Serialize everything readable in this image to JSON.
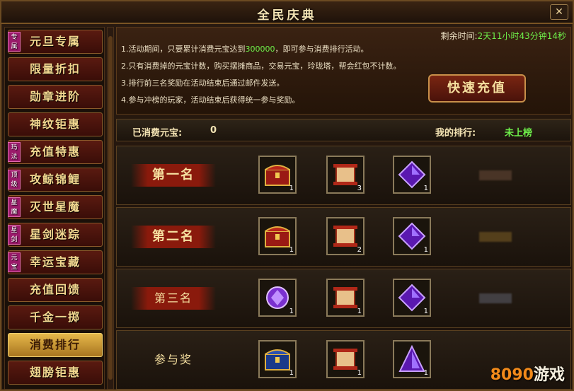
{
  "window": {
    "title": "全民庆典",
    "close_label": "✕"
  },
  "sidebar": {
    "items": [
      {
        "label": "元旦专属",
        "tag": "专属"
      },
      {
        "label": "限量折扣",
        "tag": ""
      },
      {
        "label": "勋章进阶",
        "tag": ""
      },
      {
        "label": "神纹钜惠",
        "tag": ""
      },
      {
        "label": "充值特惠",
        "tag": "玛法"
      },
      {
        "label": "攻鲸锦鲤",
        "tag": "顶级"
      },
      {
        "label": "灭世星魔",
        "tag": "星魔"
      },
      {
        "label": "星剑迷踪",
        "tag": "星剑"
      },
      {
        "label": "幸运宝藏",
        "tag": "元宝"
      },
      {
        "label": "充值回馈",
        "tag": ""
      },
      {
        "label": "千金一掷",
        "tag": ""
      },
      {
        "label": "消费排行",
        "tag": ""
      },
      {
        "label": "翅膀钜惠",
        "tag": ""
      }
    ],
    "active_index": 11
  },
  "info": {
    "countdown_label": "剩余时间:",
    "countdown_value": "2天11小时43分钟14秒",
    "rules": [
      {
        "pre": "1.活动期间，只要累计消费元宝达到",
        "hl": "300000",
        "post": "，即可参与消费排行活动。"
      },
      {
        "pre": "2.只有消费掉的元宝计数，购买摆摊商品，交易元宝，玲珑塔，帮会红包不计数。",
        "hl": "",
        "post": ""
      },
      {
        "pre": "3.排行前三名奖励在活动结束后通过邮件发送。",
        "hl": "",
        "post": ""
      },
      {
        "pre": "4.参与冲榜的玩家，活动结束后获得统一参与奖励。",
        "hl": "",
        "post": ""
      }
    ],
    "recharge_label": "快速充值"
  },
  "stats": {
    "spent_label": "已消费元宝:",
    "spent_value": "0",
    "rank_label": "我的排行:",
    "rank_value": "未上榜"
  },
  "ranks": [
    {
      "label": "第一名",
      "items": [
        {
          "icon": "treasure-chest-icon",
          "count": "1"
        },
        {
          "icon": "scroll-icon",
          "count": "3"
        },
        {
          "icon": "purple-crystal-icon",
          "count": "1"
        }
      ]
    },
    {
      "label": "第二名",
      "items": [
        {
          "icon": "treasure-chest-icon",
          "count": "1"
        },
        {
          "icon": "scroll-icon",
          "count": "2"
        },
        {
          "icon": "purple-crystal-icon",
          "count": "1"
        }
      ]
    },
    {
      "label": "第三名",
      "items": [
        {
          "icon": "gem-icon",
          "count": "1"
        },
        {
          "icon": "scroll-icon",
          "count": "1"
        },
        {
          "icon": "purple-crystal-icon",
          "count": "1"
        }
      ]
    },
    {
      "label": "参与奖",
      "items": [
        {
          "icon": "blue-chest-icon",
          "count": "1"
        },
        {
          "icon": "scroll-icon",
          "count": "1"
        },
        {
          "icon": "purple-triangle-icon",
          "count": "1"
        }
      ]
    }
  ],
  "watermark": {
    "prefix": "8090",
    "suffix": "游戏"
  }
}
